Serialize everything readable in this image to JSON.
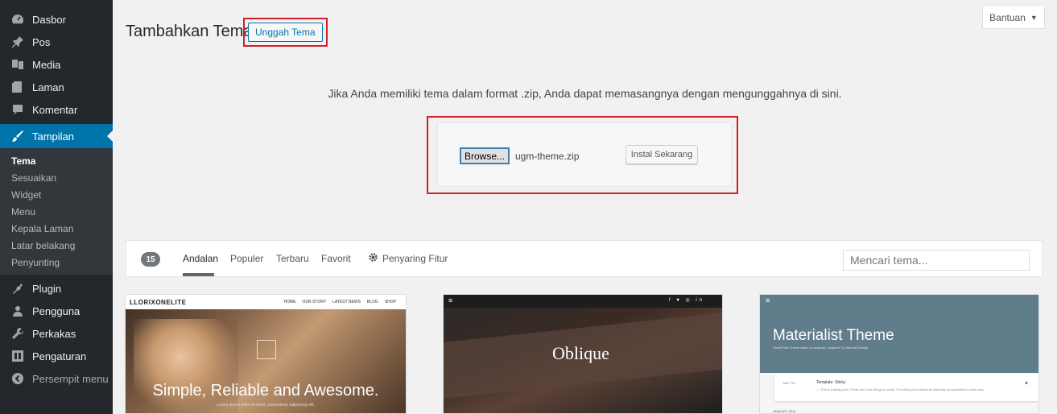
{
  "sidebar": {
    "items_top": [
      {
        "label": "Dasbor",
        "icon": "dashboard-icon"
      },
      {
        "label": "Pos",
        "icon": "pin-icon"
      },
      {
        "label": "Media",
        "icon": "media-icon"
      },
      {
        "label": "Laman",
        "icon": "page-icon"
      },
      {
        "label": "Komentar",
        "icon": "comment-icon"
      }
    ],
    "active": {
      "label": "Tampilan",
      "icon": "brush-icon"
    },
    "submenu": [
      "Tema",
      "Sesuaikan",
      "Widget",
      "Menu",
      "Kepala Laman",
      "Latar belakang",
      "Penyunting"
    ],
    "items_bottom": [
      {
        "label": "Plugin",
        "icon": "plugin-icon"
      },
      {
        "label": "Pengguna",
        "icon": "user-icon"
      },
      {
        "label": "Perkakas",
        "icon": "wrench-icon"
      },
      {
        "label": "Pengaturan",
        "icon": "settings-icon"
      }
    ],
    "collapse": "Persempit menu"
  },
  "help_tab": {
    "label": "Bantuan"
  },
  "header": {
    "title": "Tambahkan Tema",
    "upload_button": "Unggah Tema"
  },
  "upload": {
    "help_text": "Jika Anda memiliki tema dalam format .zip, Anda dapat memasangnya dengan mengunggahnya di sini.",
    "browse_label": "Browse...",
    "file_name": "ugm-theme.zip",
    "install_label": "Instal Sekarang"
  },
  "filter": {
    "count": "15",
    "tabs": [
      "Andalan",
      "Populer",
      "Terbaru",
      "Favorit"
    ],
    "feature_filter": "Penyaring Fitur",
    "search_placeholder": "Mencari tema..."
  },
  "themes": {
    "t1": {
      "logo": "LLORIXONELITE",
      "nav": [
        "HOME",
        "OUR STORY",
        "LATEST NEWS",
        "BLOG",
        "SHOP"
      ],
      "headline": "Simple, Reliable and Awesome.",
      "sub": "Lorem ipsum dolor sit amet, consectetur adipiscing elit."
    },
    "t2": {
      "title": "Oblique",
      "social": "f ♥ ◎ in"
    },
    "t3": {
      "title": "Materialist Theme",
      "tagline": "WordPress Theme which is obviously \"inspired\" by Material Design",
      "post_date": "JAN 7TH",
      "post_title": "Template: Sticky",
      "post_text": "— This is a sticky post. There are a few things to verify: The sticky post should be distinctly recognizable in some way.",
      "month": "JANUARY 2012"
    }
  },
  "colors": {
    "admin_bar": "#23282d",
    "accent": "#0073aa",
    "highlight_box": "#d21f2a",
    "background": "#f1f1f1"
  }
}
